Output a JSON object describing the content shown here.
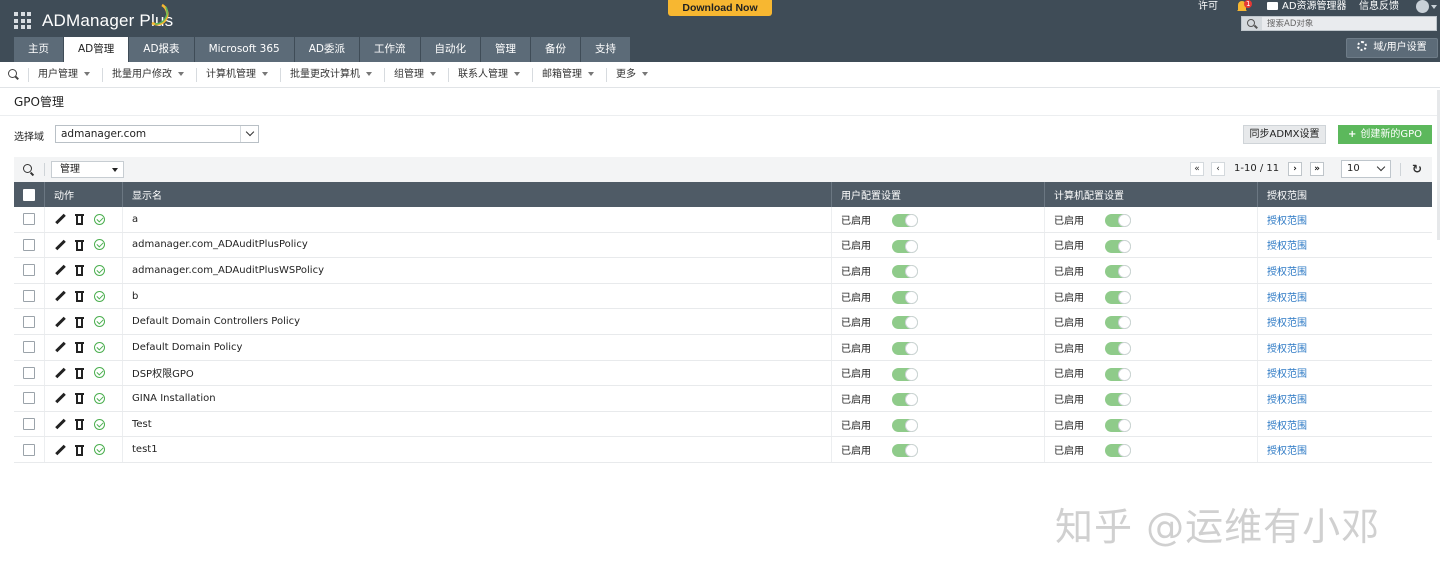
{
  "header": {
    "logo_text": "ADManager Plus",
    "download_label": "Download Now",
    "license_label": "许可",
    "notification_count": "1",
    "ad_explorer_label": "AD资源管理器",
    "feedback_label": "信息反馈",
    "search_placeholder": "搜索AD对象",
    "domain_user_settings_label": "域/用户设置",
    "tabs": [
      {
        "label": "主页",
        "active": false
      },
      {
        "label": "AD管理",
        "active": true
      },
      {
        "label": "AD报表",
        "active": false
      },
      {
        "label": "Microsoft 365",
        "active": false
      },
      {
        "label": "AD委派",
        "active": false
      },
      {
        "label": "工作流",
        "active": false
      },
      {
        "label": "自动化",
        "active": false
      },
      {
        "label": "管理",
        "active": false
      },
      {
        "label": "备份",
        "active": false
      },
      {
        "label": "支持",
        "active": false
      }
    ]
  },
  "submenu": {
    "items": [
      "用户管理",
      "批量用户修改",
      "计算机管理",
      "批量更改计算机",
      "组管理",
      "联系人管理",
      "邮箱管理",
      "更多"
    ]
  },
  "page": {
    "title": "GPO管理",
    "domain_label": "选择域",
    "domain_value": "admanager.com",
    "sync_label": "同步ADMX设置",
    "create_label": "创建新的GPO"
  },
  "toolbar": {
    "filter_value": "管理",
    "pagination": "1-10 / 11",
    "per_page": "10"
  },
  "table": {
    "headers": {
      "action": "动作",
      "name": "显示名",
      "user_config": "用户配置设置",
      "computer_config": "计算机配置设置",
      "scope": "授权范围"
    },
    "rows": [
      {
        "name": "a",
        "user_status": "已启用",
        "user_enabled": true,
        "computer_status": "已启用",
        "computer_enabled": true,
        "scope": "授权范围"
      },
      {
        "name": "admanager.com_ADAuditPlusPolicy",
        "user_status": "已启用",
        "user_enabled": true,
        "computer_status": "已启用",
        "computer_enabled": true,
        "scope": "授权范围"
      },
      {
        "name": "admanager.com_ADAuditPlusWSPolicy",
        "user_status": "已启用",
        "user_enabled": true,
        "computer_status": "已启用",
        "computer_enabled": true,
        "scope": "授权范围"
      },
      {
        "name": "b",
        "user_status": "已启用",
        "user_enabled": true,
        "computer_status": "已启用",
        "computer_enabled": true,
        "scope": "授权范围"
      },
      {
        "name": "Default Domain Controllers Policy",
        "user_status": "已启用",
        "user_enabled": true,
        "computer_status": "已启用",
        "computer_enabled": true,
        "scope": "授权范围"
      },
      {
        "name": "Default Domain Policy",
        "user_status": "已启用",
        "user_enabled": true,
        "computer_status": "已启用",
        "computer_enabled": true,
        "scope": "授权范围"
      },
      {
        "name": "DSP权限GPO",
        "user_status": "已启用",
        "user_enabled": true,
        "computer_status": "已启用",
        "computer_enabled": true,
        "scope": "授权范围"
      },
      {
        "name": "GINA Installation",
        "user_status": "已启用",
        "user_enabled": true,
        "computer_status": "已启用",
        "computer_enabled": true,
        "scope": "授权范围"
      },
      {
        "name": "Test",
        "user_status": "已启用",
        "user_enabled": true,
        "computer_status": "已启用",
        "computer_enabled": true,
        "scope": "授权范围"
      },
      {
        "name": "test1",
        "user_status": "已启用",
        "user_enabled": true,
        "computer_status": "已启用",
        "computer_enabled": true,
        "scope": "授权范围"
      }
    ]
  },
  "watermark": "知乎 @运维有小邓",
  "colors": {
    "header_bg": "#3f4c57",
    "tab_bg": "#5c6b78",
    "download_bg": "#f7b731",
    "create_bg": "#5cb85c",
    "table_header_bg": "#4f5b66",
    "toggle_on": "#8fcb8a",
    "link": "#2b78c4"
  }
}
